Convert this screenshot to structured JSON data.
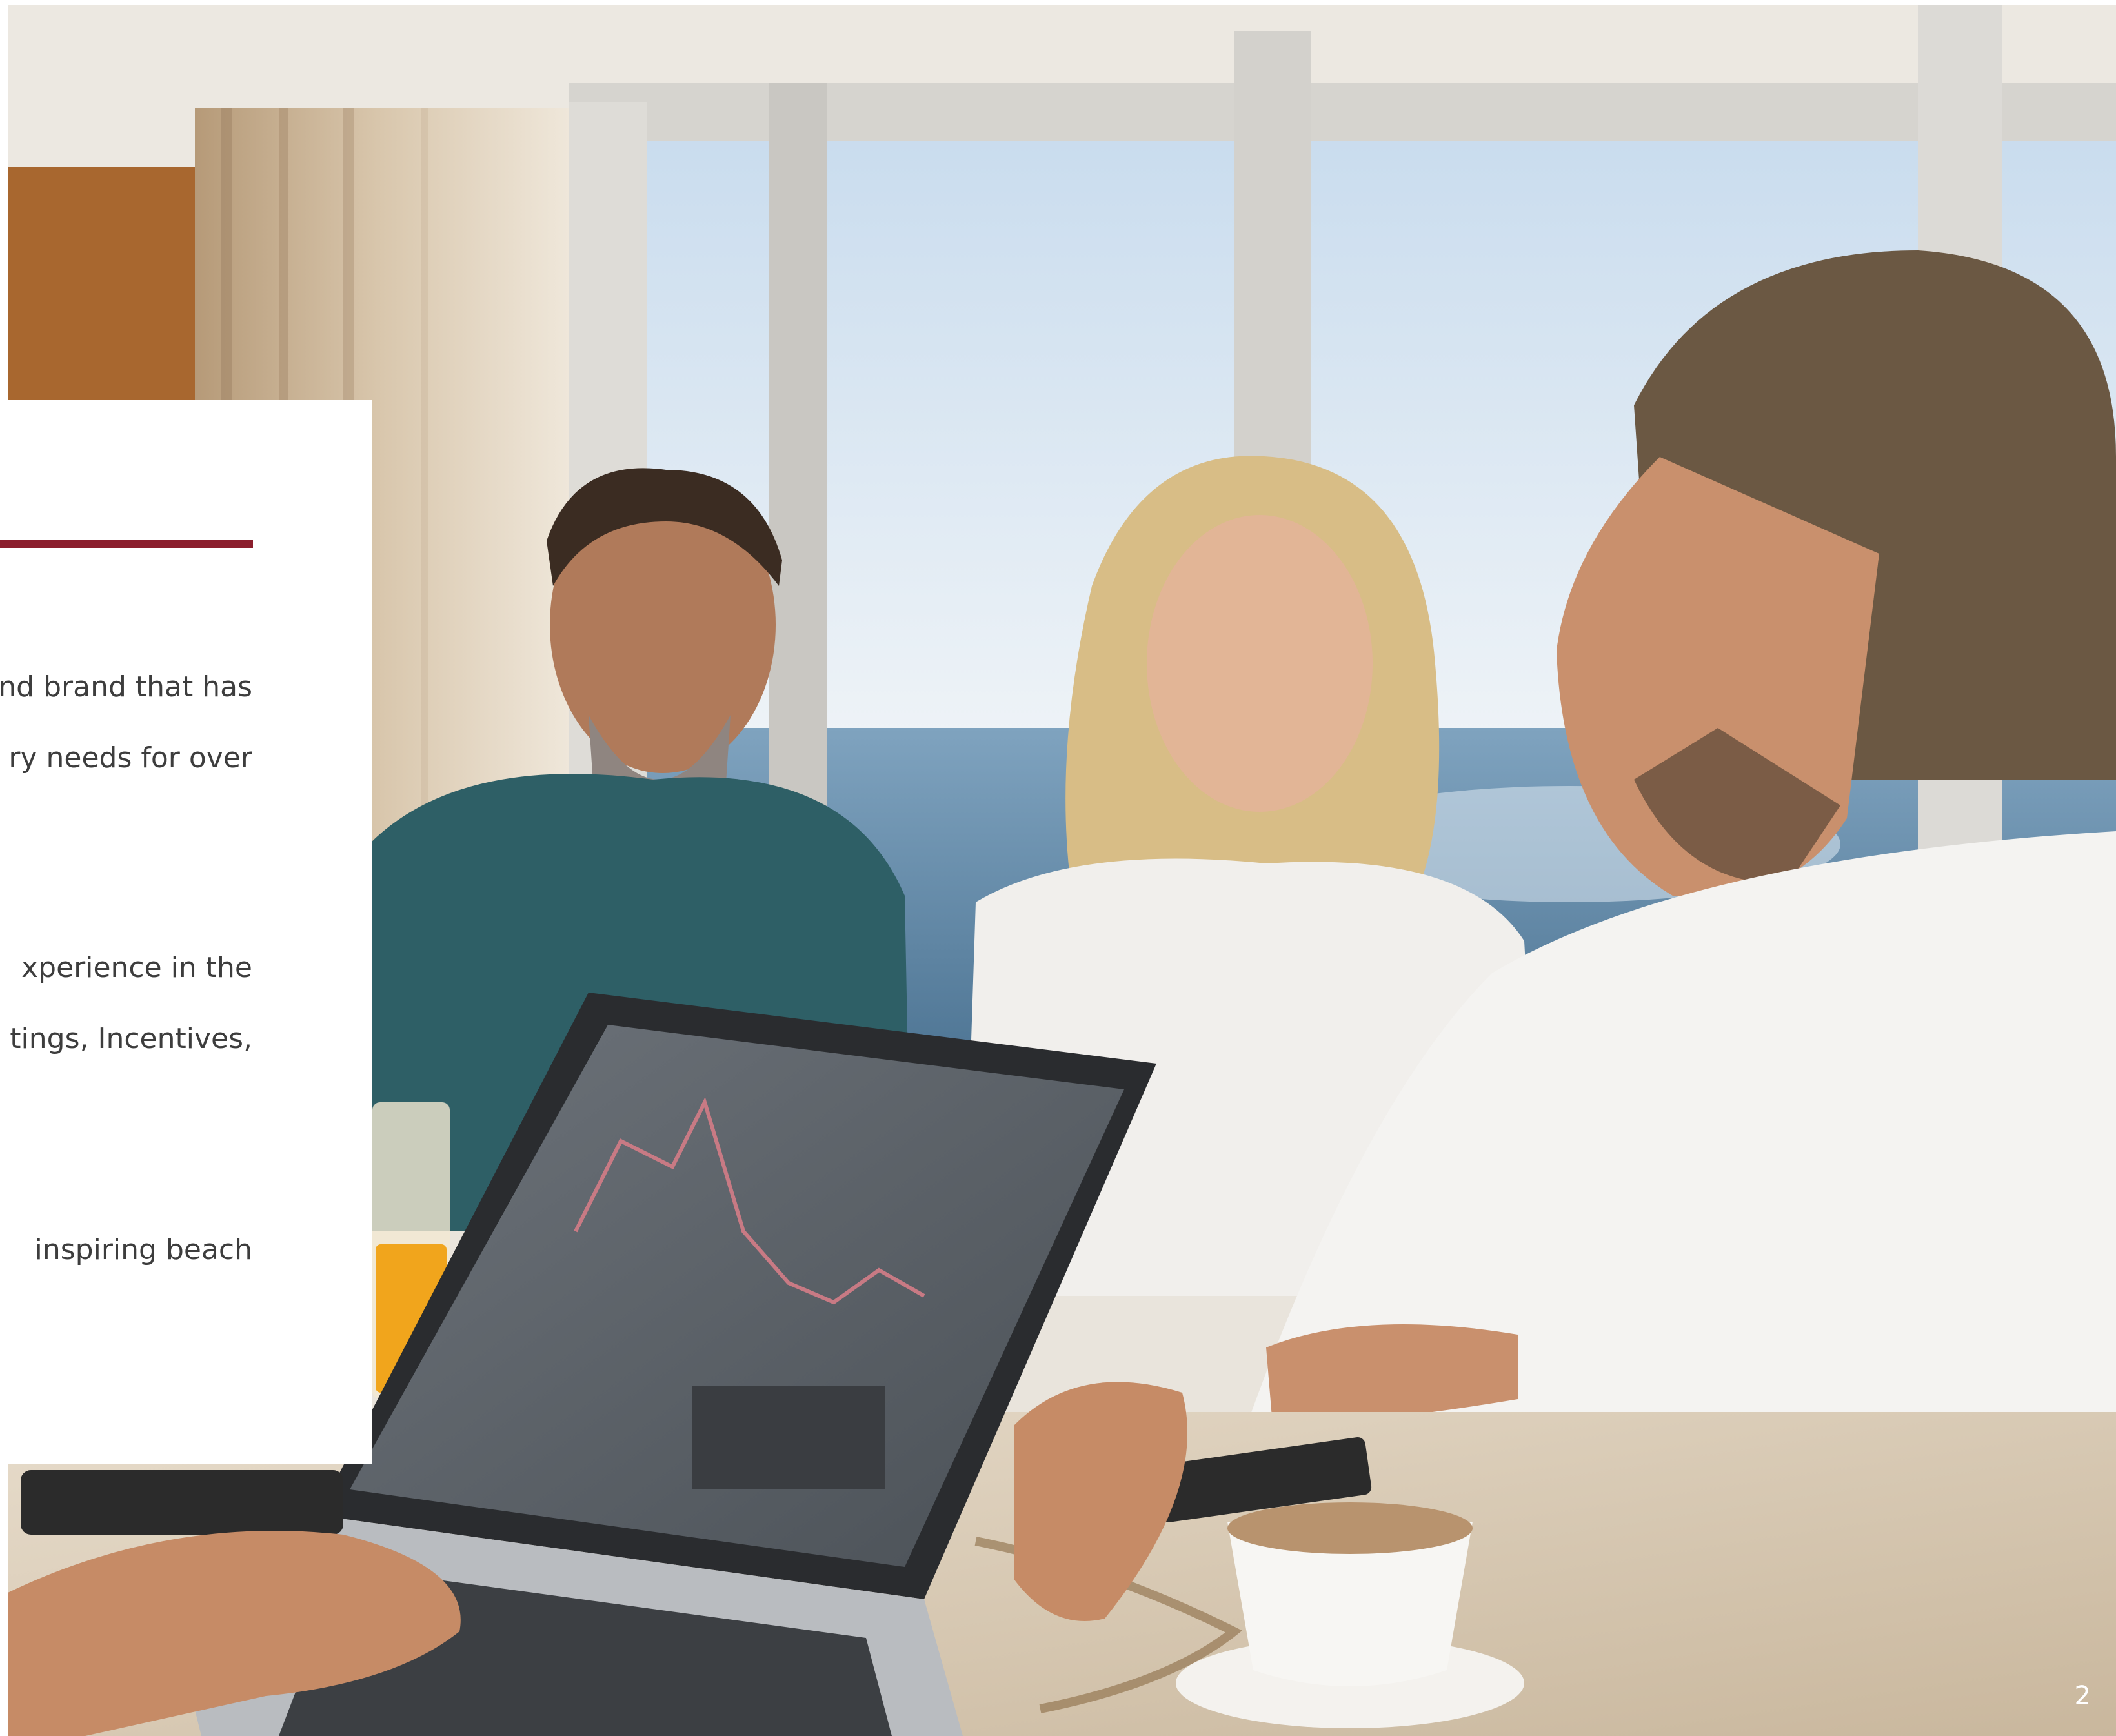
{
  "paragraphs": [
    {
      "lines": [
        "nd brand that has",
        "ry needs for over"
      ]
    },
    {
      "lines": [
        "xperience  in  the",
        "tings, Incentives,"
      ]
    },
    {
      "lines": [
        " inspiring  beach"
      ]
    }
  ],
  "page_number": "2",
  "colors": {
    "accent": "#8b1e2d",
    "body_text": "#3d3d3d",
    "card": "#ffffff"
  },
  "photo": {
    "subject": "meeting-photo"
  }
}
